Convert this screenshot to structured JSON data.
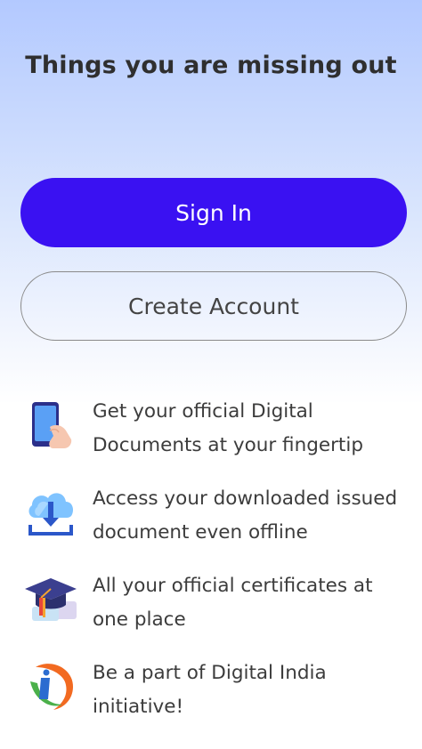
{
  "header": {
    "title": "Things you are missing out"
  },
  "buttons": {
    "sign_in": "Sign In",
    "create_account": "Create Account"
  },
  "features": [
    {
      "icon": "phone-hand-icon",
      "text": "Get your official Digital Documents at your fingertip"
    },
    {
      "icon": "cloud-download-icon",
      "text": "Access your downloaded issued document even offline"
    },
    {
      "icon": "graduation-cap-icon",
      "text": "All your official certificates at one place"
    },
    {
      "icon": "digital-india-logo-icon",
      "text": "Be a part of Digital India initiative!"
    }
  ],
  "colors": {
    "primary": "#3a11f2",
    "background_top": "#b3c9ff",
    "text": "#3c3c3c"
  }
}
